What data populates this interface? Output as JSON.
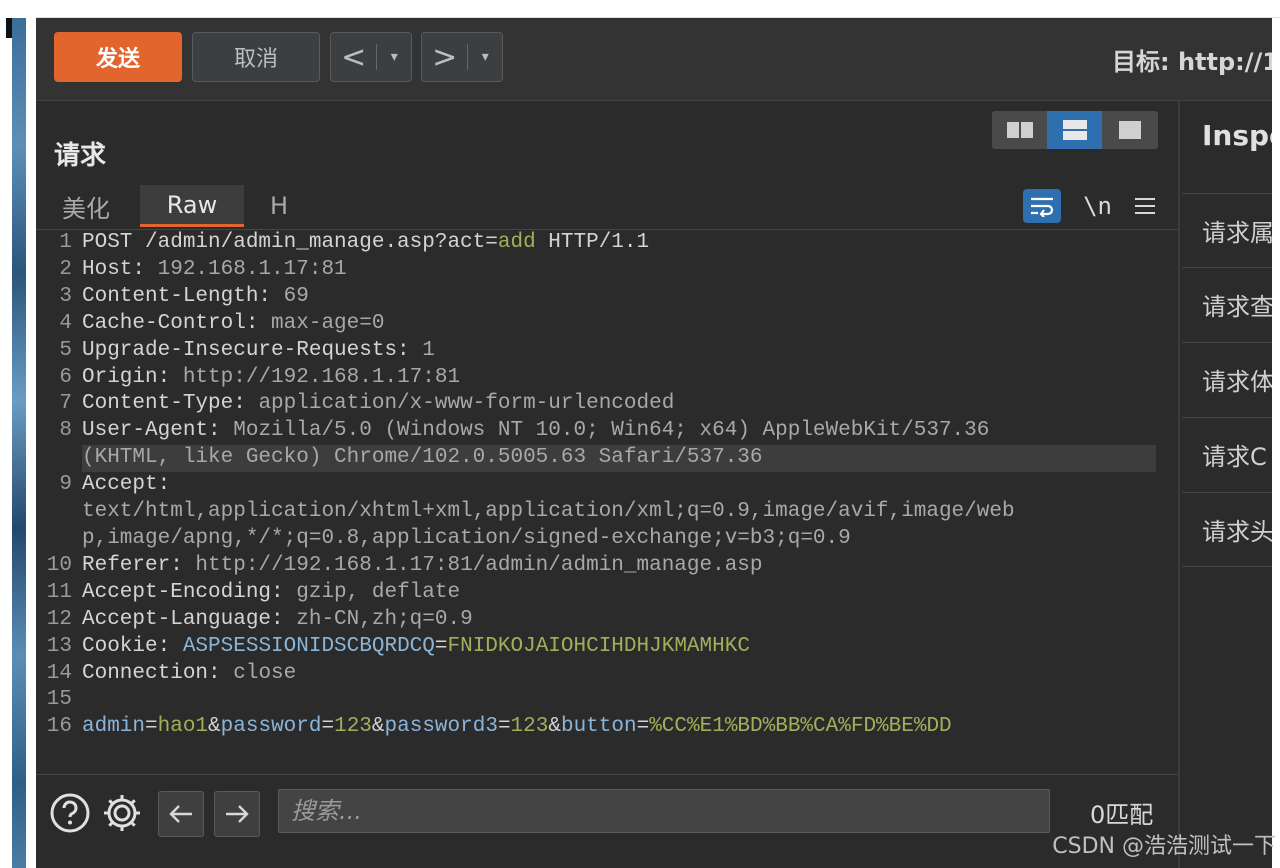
{
  "toolbar": {
    "send_label": "发送",
    "cancel_label": "取消",
    "back_arrow": "<",
    "forward_arrow": ">",
    "caret": "▾",
    "target_label": "目标: http://1"
  },
  "request": {
    "title": "请求",
    "tabs": [
      "美化",
      "Raw",
      "H"
    ],
    "newline_label": "\\n"
  },
  "editor": {
    "lines": [
      {
        "n": "1",
        "parts": [
          [
            "k",
            "POST /admin/admin_manage.asp?act="
          ],
          [
            "g",
            "add"
          ],
          [
            "k",
            " HTTP/1.1"
          ]
        ]
      },
      {
        "n": "2",
        "parts": [
          [
            "k",
            "Host: "
          ],
          [
            "v",
            "192.168.1.17:81"
          ]
        ]
      },
      {
        "n": "3",
        "parts": [
          [
            "k",
            "Content-Length: "
          ],
          [
            "v",
            "69"
          ]
        ]
      },
      {
        "n": "4",
        "parts": [
          [
            "k",
            "Cache-Control: "
          ],
          [
            "v",
            "max-age=0"
          ]
        ]
      },
      {
        "n": "5",
        "parts": [
          [
            "k",
            "Upgrade-Insecure-Requests: "
          ],
          [
            "v",
            "1"
          ]
        ]
      },
      {
        "n": "6",
        "parts": [
          [
            "k",
            "Origin: "
          ],
          [
            "v",
            "http://192.168.1.17:81"
          ]
        ]
      },
      {
        "n": "7",
        "parts": [
          [
            "k",
            "Content-Type: "
          ],
          [
            "v",
            "application/x-www-form-urlencoded"
          ]
        ]
      },
      {
        "n": "8",
        "parts": [
          [
            "k",
            "User-Agent: "
          ],
          [
            "v",
            "Mozilla/5.0 (Windows NT 10.0; Win64; x64) AppleWebKit/537.36"
          ]
        ]
      },
      {
        "n": "",
        "cont": true,
        "hl": true,
        "parts": [
          [
            "v",
            "(KHTML, like Gecko) Chrome/102.0.5005.63 Safari/537.36"
          ]
        ]
      },
      {
        "n": "9",
        "parts": [
          [
            "k",
            "Accept: "
          ]
        ]
      },
      {
        "n": "",
        "cont": true,
        "parts": [
          [
            "v",
            "text/html,application/xhtml+xml,application/xml;q=0.9,image/avif,image/web"
          ]
        ]
      },
      {
        "n": "",
        "cont": true,
        "parts": [
          [
            "v",
            "p,image/apng,*/*;q=0.8,application/signed-exchange;v=b3;q=0.9"
          ]
        ]
      },
      {
        "n": "10",
        "parts": [
          [
            "k",
            "Referer: "
          ],
          [
            "v",
            "http://192.168.1.17:81/admin/admin_manage.asp"
          ]
        ]
      },
      {
        "n": "11",
        "parts": [
          [
            "k",
            "Accept-Encoding: "
          ],
          [
            "v",
            "gzip, deflate"
          ]
        ]
      },
      {
        "n": "12",
        "parts": [
          [
            "k",
            "Accept-Language: "
          ],
          [
            "v",
            "zh-CN,zh;q=0.9"
          ]
        ]
      },
      {
        "n": "13",
        "parts": [
          [
            "k",
            "Cookie: "
          ],
          [
            "b",
            "ASPSESSIONIDSCBQRDCQ"
          ],
          [
            "k",
            "="
          ],
          [
            "g",
            "FNIDKOJAIOHCIHDHJKMAMHKC"
          ]
        ]
      },
      {
        "n": "14",
        "parts": [
          [
            "k",
            "Connection: "
          ],
          [
            "v",
            "close"
          ]
        ]
      },
      {
        "n": "15",
        "parts": []
      },
      {
        "n": "16",
        "parts": [
          [
            "b",
            "admin"
          ],
          [
            "k",
            "="
          ],
          [
            "g",
            "hao1"
          ],
          [
            "k",
            "&"
          ],
          [
            "b",
            "password"
          ],
          [
            "k",
            "="
          ],
          [
            "g",
            "123"
          ],
          [
            "k",
            "&"
          ],
          [
            "b",
            "password3"
          ],
          [
            "k",
            "="
          ],
          [
            "g",
            "123"
          ],
          [
            "k",
            "&"
          ],
          [
            "b",
            "button"
          ],
          [
            "k",
            "="
          ],
          [
            "g",
            "%CC%E1%BD%BB%CA%FD%BE%DD"
          ]
        ]
      }
    ]
  },
  "search": {
    "placeholder": "搜索...",
    "matches": "0匹配"
  },
  "inspector": {
    "title": "Inspe",
    "items": [
      "请求属",
      "请求查",
      "请求体",
      "请求C",
      "请求头"
    ]
  },
  "watermark": "CSDN @浩浩测试一下",
  "colors": {
    "accent": "#e2652e",
    "active_blue": "#2e6fb0",
    "value_green": "#9fb05a",
    "param_blue": "#8ab4d8"
  }
}
